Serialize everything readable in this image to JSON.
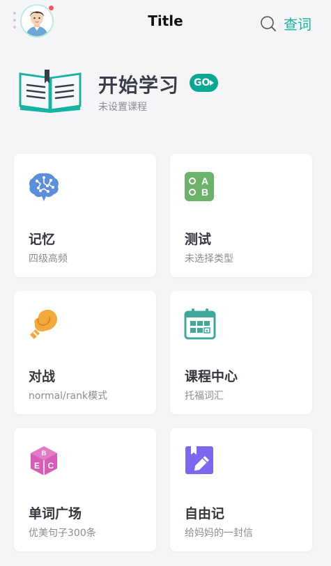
{
  "header": {
    "title": "Title",
    "search_label": "查词"
  },
  "hero": {
    "title": "开始学习",
    "go_label": "GO",
    "subtitle": "未设置课程"
  },
  "cards": [
    {
      "title": "记忆",
      "subtitle": "四级高频",
      "icon": "brain-icon"
    },
    {
      "title": "测试",
      "subtitle": "未选择类型",
      "icon": "ab-quiz-icon"
    },
    {
      "title": "对战",
      "subtitle": "normal/rank模式",
      "icon": "boxing-glove-icon"
    },
    {
      "title": "课程中心",
      "subtitle": "托福词汇",
      "icon": "calendar-icon"
    },
    {
      "title": "单词广场",
      "subtitle": "优美句子300条",
      "icon": "word-cube-icon"
    },
    {
      "title": "自由记",
      "subtitle": "给妈妈的一封信",
      "icon": "edit-note-icon"
    }
  ],
  "colors": {
    "accent": "#16b4a0",
    "go_badge": "#0aa792",
    "brain": "#5b8fdc",
    "quiz": "#6bb36b",
    "glove": "#f0a93a",
    "calendar": "#3fa89a",
    "cube": "#d85db8",
    "edit": "#7b68ee"
  }
}
